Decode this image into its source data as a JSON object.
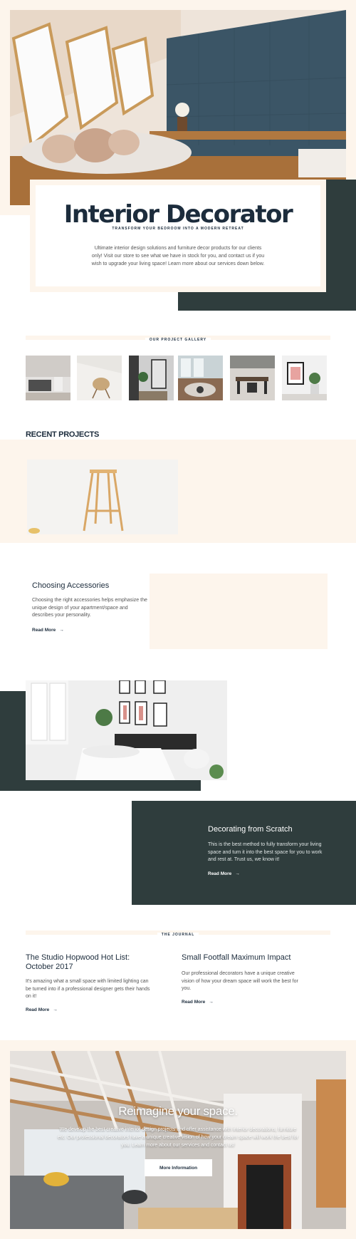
{
  "hero": {
    "title": "Interior Decorator",
    "tagline": "TRANSFORM YOUR BEDROOM INTO A MODERN RETREAT",
    "description": "Ultimate interior design solutions and furniture decor products for our clients only! Visit our store to see what we have in stock for you, and contact us if you wish to upgrade your living space! Learn more about our services down below."
  },
  "gallery": {
    "label": "OUR PROJECT GALLERY"
  },
  "recent": {
    "title": "RECENT PROJECTS"
  },
  "projects": [
    {
      "title": "Choosing Accessories",
      "text": "Choosing the right accessories helps emphasize the unique design of your apartment/space and describes your personality.",
      "link": "Read More"
    },
    {
      "title": "Decorating from Scratch",
      "text": "This is the best method to fully transform your living space and turn it into the best space for you to work and rest at. Trust us, we know it!",
      "link": "Read More"
    }
  ],
  "journal": {
    "label": "THE JOURNAL",
    "posts": [
      {
        "title": "The Studio Hopwood Hot List: October 2017",
        "text": "It's amazing what a small space with limited lighting can be turned into if a professional designer gets their hands on it!",
        "link": "Read More"
      },
      {
        "title": "Small Footfall Maximum Impact",
        "text": "Our professional decorators have a unique creative vision of how your dream space will work the best for you.",
        "link": "Read More"
      }
    ]
  },
  "cta": {
    "title": "Reimagine your space.",
    "description": "We develop the best creative interior design projects and offer assistance with interior decorations, furniture etc. Our professional decorators have a unique creative vision of how your dream space will work the best for you. Learn more about our services and contact us!",
    "button": "More Information"
  },
  "icons": {
    "arrow": "arrow-right-icon"
  },
  "colors": {
    "cream": "#fdf5ec",
    "dark": "#2f3d3d",
    "navy": "#1c2c3c"
  }
}
